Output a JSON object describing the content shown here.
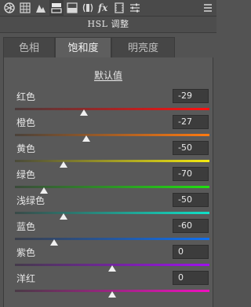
{
  "toolbar": {
    "icons": [
      "aperture-icon",
      "grid-icon",
      "mountain-icon",
      "split-tone-icon",
      "detail-icon",
      "lens-icon",
      "fx-icon",
      "film-icon",
      "sliders-icon",
      "menu-icon"
    ],
    "active_index": 3
  },
  "panel": {
    "title": "HSL 调整"
  },
  "tabs": [
    {
      "label": "色相",
      "active": false
    },
    {
      "label": "饱和度",
      "active": true
    },
    {
      "label": "明亮度",
      "active": false
    }
  ],
  "default_link": "默认值",
  "sliders": [
    {
      "label": "红色",
      "value": "-29",
      "level": -29,
      "gradient": [
        "#4a3a3a",
        "#ff1010"
      ]
    },
    {
      "label": "橙色",
      "value": "-27",
      "level": -27,
      "gradient": [
        "#4a423a",
        "#ff7a10"
      ]
    },
    {
      "label": "黄色",
      "value": "-50",
      "level": -50,
      "gradient": [
        "#4a4a3a",
        "#f5ea10"
      ]
    },
    {
      "label": "绿色",
      "value": "-70",
      "level": -70,
      "gradient": [
        "#3a4a3a",
        "#20e010"
      ]
    },
    {
      "label": "浅绿色",
      "value": "-50",
      "level": -50,
      "gradient": [
        "#3a4a48",
        "#10e0c8"
      ]
    },
    {
      "label": "蓝色",
      "value": "-60",
      "level": -60,
      "gradient": [
        "#3a3e4a",
        "#1070f0"
      ]
    },
    {
      "label": "紫色",
      "value": "0",
      "level": 0,
      "gradient": [
        "#443a4a",
        "#a010f0"
      ]
    },
    {
      "label": "洋红",
      "value": "0",
      "level": 0,
      "gradient": [
        "#4a3a46",
        "#f010c0"
      ]
    }
  ],
  "range": [
    -100,
    100
  ]
}
